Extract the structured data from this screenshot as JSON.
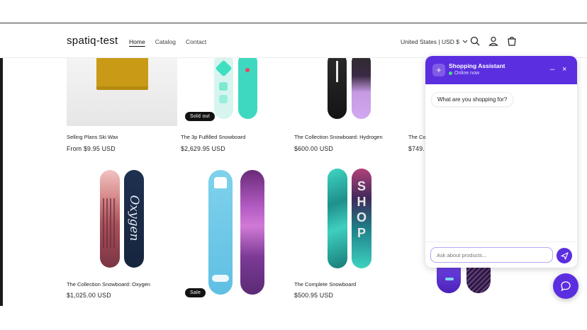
{
  "header": {
    "logo": "spatiq-test",
    "nav": [
      "Home",
      "Catalog",
      "Contact"
    ],
    "country": "United States | USD $"
  },
  "products": [
    {
      "title": "Selling Plans Ski Wax",
      "price": "From $9.95 USD"
    },
    {
      "title": "The 3p Fulfilled Snowboard",
      "price": "$2,629.95 USD",
      "badge": "Sold out"
    },
    {
      "title": "The Collection Snowboard: Hydrogen",
      "price": "$600.00 USD"
    },
    {
      "title": "The Co",
      "price": "$749."
    },
    {
      "title": "The Collection Snowboard: Oxygen",
      "price": "$1,025.00 USD"
    },
    {
      "title": "",
      "price": "",
      "badge": "Sale"
    },
    {
      "title": "The Complete Snowboard",
      "price": "$500.95 USD"
    }
  ],
  "chat": {
    "title": "Shopping Assistant",
    "status": "Online now",
    "message": "What are you shopping for?",
    "placeholder": "Ask about products...",
    "accent": "#5b2ee0"
  }
}
